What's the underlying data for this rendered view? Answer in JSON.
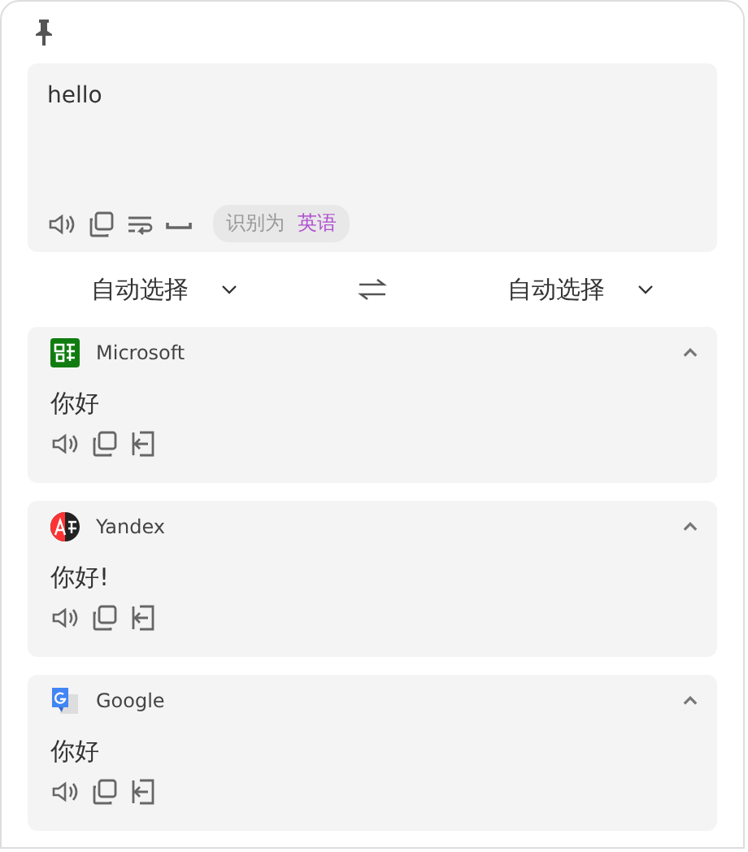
{
  "source": {
    "text": "hello",
    "detected_label": "识别为",
    "detected_language": "英语"
  },
  "languages": {
    "from": "自动选择",
    "to": "自动选择"
  },
  "results": [
    {
      "kind": "microsoft",
      "service": "Microsoft",
      "expanded": true,
      "text": "你好"
    },
    {
      "kind": "yandex",
      "service": "Yandex",
      "expanded": true,
      "text": "你好!"
    },
    {
      "kind": "google",
      "service": "Google",
      "expanded": true,
      "text": "你好"
    }
  ]
}
